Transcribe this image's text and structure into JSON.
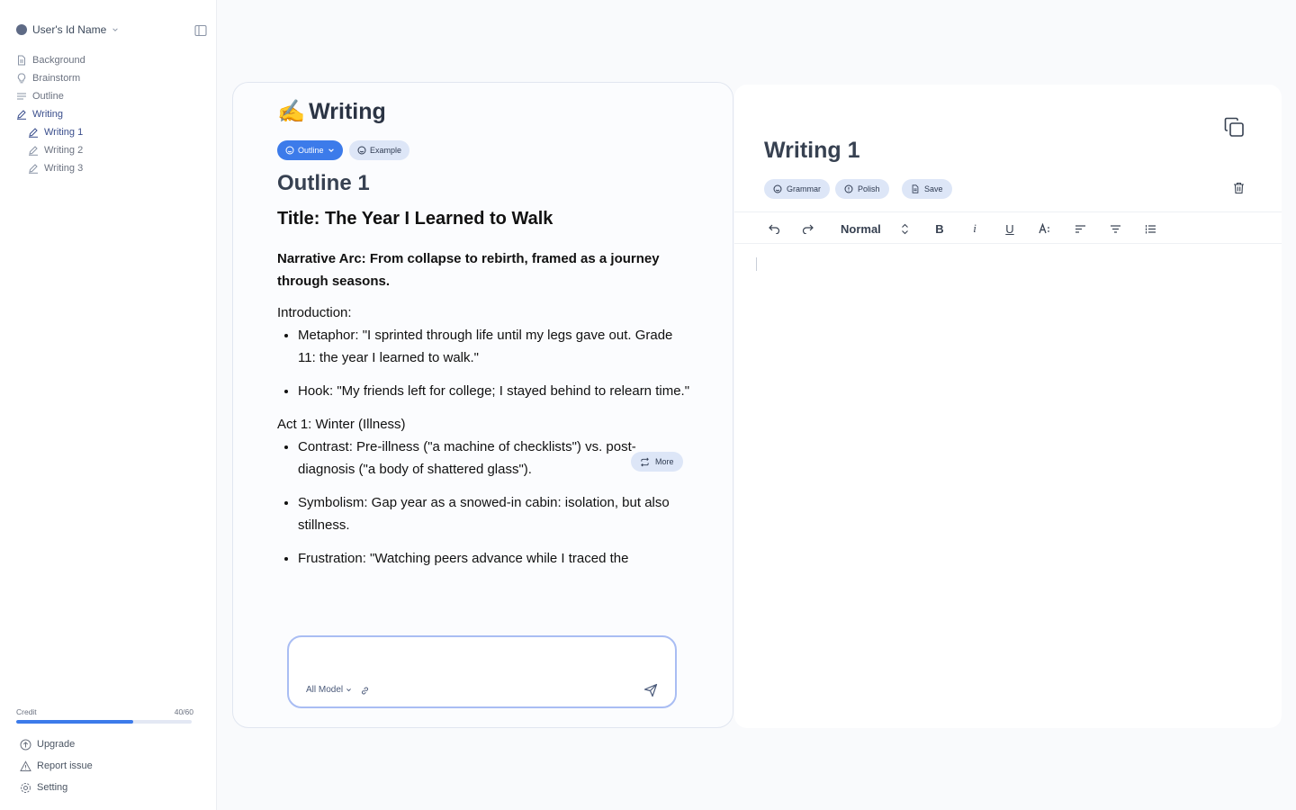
{
  "sidebar": {
    "user_name": "User's Id Name",
    "items": [
      {
        "label": "Background",
        "icon": "document-icon"
      },
      {
        "label": "Brainstorm",
        "icon": "lightbulb-icon"
      },
      {
        "label": "Outline",
        "icon": "lines-icon"
      },
      {
        "label": "Writing",
        "icon": "pen-icon",
        "active": true
      },
      {
        "label": "Writing 1",
        "icon": "pen-icon",
        "sub": true,
        "active": true
      },
      {
        "label": "Writing 2",
        "icon": "pen-icon",
        "sub": true
      },
      {
        "label": "Writing 3",
        "icon": "pen-icon",
        "sub": true
      }
    ],
    "credit": {
      "label": "Credit",
      "value": "40/60",
      "used": 40,
      "total": 60
    },
    "bottom": [
      {
        "label": "Upgrade",
        "icon": "arrow-up-circle-icon"
      },
      {
        "label": "Report issue",
        "icon": "warning-triangle-icon"
      },
      {
        "label": "Setting",
        "icon": "gear-icon"
      }
    ]
  },
  "left_panel": {
    "emoji": "✍️",
    "title": "Writing",
    "outline_pill": "Outline",
    "example_pill": "Example",
    "outline_heading": "Outline 1",
    "essay_title": "Title: The Year I Learned to Walk",
    "narrative_arc": "Narrative Arc: From collapse to rebirth, framed as a journey through seasons.",
    "sections": [
      {
        "heading": "Introduction:",
        "bullets": [
          "Metaphor: \"I sprinted through life until my legs gave out. Grade 11: the year I learned to walk.\"",
          "Hook: \"My friends left for college; I stayed behind to relearn time.\""
        ]
      },
      {
        "heading": "Act 1: Winter (Illness)",
        "bullets": [
          "Contrast: Pre-illness (\"a machine of checklists\") vs. post-diagnosis (\"a body of shattered glass\").",
          "Symbolism: Gap year as a snowed-in cabin: isolation, but also stillness.",
          "Frustration: \"Watching peers advance while I traced the"
        ]
      }
    ],
    "more_label": "More",
    "chat": {
      "placeholder": "",
      "model_label": "All Model"
    }
  },
  "right_panel": {
    "doc_title": "Writing 1",
    "grammar_label": "Grammar",
    "polish_label": "Polish",
    "save_label": "Save",
    "toolbar": {
      "style_value": "Normal",
      "bold": "B",
      "italic": "i",
      "underline": "U"
    }
  },
  "colors": {
    "accent": "#3c7bea",
    "pill_light": "#dde6f7",
    "chat_border": "#a9bdf3"
  }
}
